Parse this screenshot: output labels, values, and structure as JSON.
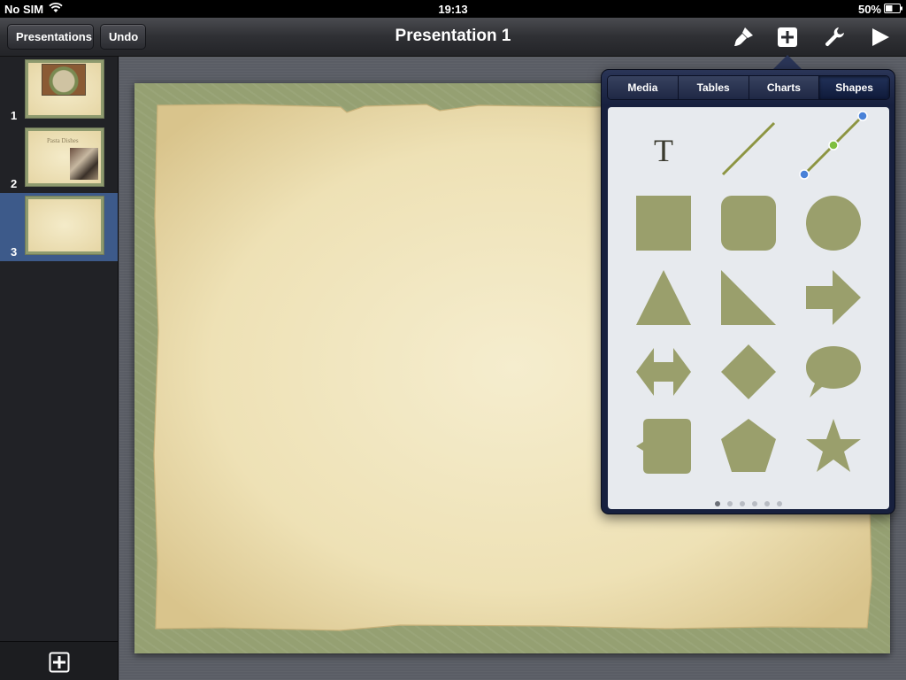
{
  "status_bar": {
    "carrier": "No SIM",
    "time": "19:13",
    "battery_percent": "50%",
    "battery_level": 0.5
  },
  "toolbar": {
    "presentations_label": "Presentations",
    "undo_label": "Undo",
    "title": "Presentation 1",
    "icons": [
      "paintbrush-icon",
      "add-icon",
      "wrench-icon",
      "play-icon"
    ]
  },
  "navigator": {
    "slides": [
      {
        "number": "1",
        "selected": false
      },
      {
        "number": "2",
        "title": "Pasta Dishes",
        "selected": false
      },
      {
        "number": "3",
        "selected": true
      }
    ],
    "add_slide_icon": "add-slide-icon"
  },
  "popover": {
    "tabs": [
      "Media",
      "Tables",
      "Charts",
      "Shapes"
    ],
    "active_tab": "Shapes",
    "text_shape_glyph": "T",
    "shapes": [
      "text-shape",
      "line-shape",
      "connection-line-shape",
      "square-shape",
      "rounded-square-shape",
      "circle-shape",
      "triangle-shape",
      "right-triangle-shape",
      "arrow-shape",
      "double-arrow-shape",
      "diamond-shape",
      "speech-bubble-shape",
      "callout-square-shape",
      "pentagon-shape",
      "star-shape"
    ],
    "page_count": 6,
    "current_page": 1
  },
  "colors": {
    "shape_fill": "#9a9f6c",
    "selection_blue": "#3d5a8a",
    "popover_navy": "#17203e"
  }
}
